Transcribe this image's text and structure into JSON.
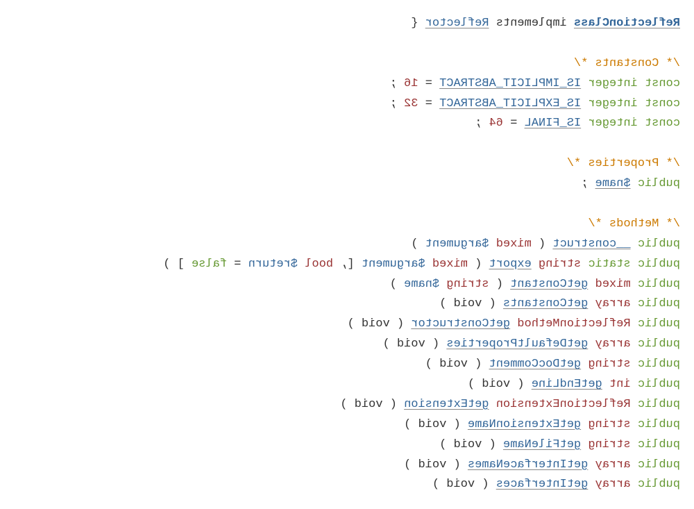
{
  "header": {
    "class_name": "ReflectionClass",
    "implements_kw": "implements",
    "interface": "Reflector",
    "open_brace": " {"
  },
  "comments": {
    "constants": "/* Constants */",
    "properties": "/* Properties */",
    "methods": "/* Methods */"
  },
  "constants": [
    {
      "const_kw": "const",
      "type_kw": "integer",
      "name": "IS_IMPLICIT_ABSTRACT",
      "eq": " = ",
      "value": "16",
      "end": " ;"
    },
    {
      "const_kw": "const",
      "type_kw": "integer",
      "name": "IS_EXPLICIT_ABSTRACT",
      "eq": " = ",
      "value": "32",
      "end": " ;"
    },
    {
      "const_kw": "const",
      "type_kw": "integer",
      "name": "IS_FINAL",
      "eq": " = ",
      "value": "64",
      "end": " ;"
    }
  ],
  "properties": [
    {
      "modifier": "public",
      "name": "$name",
      "end": " ;"
    }
  ],
  "methods": {
    "construct": {
      "modifier": "public",
      "name": "__construct",
      "open": " ( ",
      "ptype": "mixed",
      "pname": "$argument",
      "close": " )"
    },
    "export": {
      "modifier1": "public",
      "modifier2": "static",
      "rettype": "string",
      "name": "export",
      "open": " ( ",
      "ptype1": "mixed",
      "pname1": "$argument",
      "optstart": " [, ",
      "ptype2": "bool",
      "pname2": "$return",
      "eq": " = ",
      "defval": "false",
      "optend": " ] )"
    },
    "getConstant": {
      "modifier": "public",
      "rettype": "mixed",
      "name": "getConstant",
      "open": " ( ",
      "ptype": "string",
      "pname": "$name",
      "close": " )"
    },
    "simple": [
      {
        "modifier": "public",
        "rettype": "array",
        "name": "getConstants",
        "params": " ( void )"
      },
      {
        "modifier": "public",
        "rettype": "ReflectionMethod",
        "name": "getConstructor",
        "params": " ( void )"
      },
      {
        "modifier": "public",
        "rettype": "array",
        "name": "getDefaultProperties",
        "params": " ( void )"
      },
      {
        "modifier": "public",
        "rettype": "string",
        "name": "getDocComment",
        "params": " ( void )"
      },
      {
        "modifier": "public",
        "rettype": "int",
        "name": "getEndLine",
        "params": " ( void )"
      },
      {
        "modifier": "public",
        "rettype": "ReflectionExtension",
        "name": "getExtension",
        "params": " ( void )"
      },
      {
        "modifier": "public",
        "rettype": "string",
        "name": "getExtensionName",
        "params": " ( void )"
      },
      {
        "modifier": "public",
        "rettype": "string",
        "name": "getFileName",
        "params": " ( void )"
      },
      {
        "modifier": "public",
        "rettype": "array",
        "name": "getInterfaceNames",
        "params": " ( void )"
      },
      {
        "modifier": "public",
        "rettype": "array",
        "name": "getInterfaces",
        "params": " ( void )"
      }
    ]
  }
}
